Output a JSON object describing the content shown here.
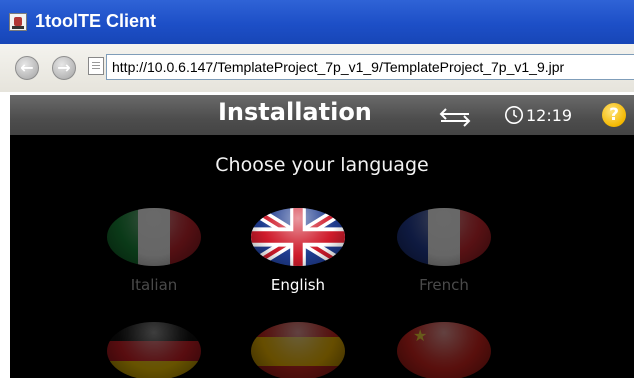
{
  "window": {
    "title": "1toolTE Client"
  },
  "browser": {
    "address": "http://10.0.6.147/TemplateProject_7p_v1_9/TemplateProject_7p_v1_9.jpr"
  },
  "app": {
    "title": "Installation",
    "time": "12:19",
    "help_label": "?",
    "subtitle": "Choose your language",
    "languages": [
      {
        "label": "Italian",
        "selected": false
      },
      {
        "label": "English",
        "selected": true
      },
      {
        "label": "French",
        "selected": false
      },
      {
        "label": "",
        "selected": false
      },
      {
        "label": "",
        "selected": false
      },
      {
        "label": "",
        "selected": false
      }
    ]
  },
  "colors": {
    "titlebar": "#1d4fc7",
    "header": "#4d4d4d",
    "background": "#000000",
    "help": "#f4b800"
  },
  "icons": [
    "app-icon",
    "back-icon",
    "forward-icon",
    "page-icon",
    "swap-arrows-icon",
    "clock-icon",
    "help-icon"
  ]
}
